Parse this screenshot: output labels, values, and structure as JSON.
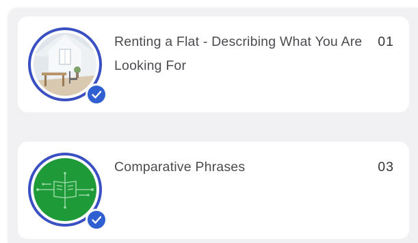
{
  "lessons": [
    {
      "title": "Renting a Flat - Describing What You Are Looking For",
      "number": "01",
      "thumbnail_icon": "room-interior-icon",
      "completed": true
    },
    {
      "title": "Comparative Phrases",
      "number": "03",
      "thumbnail_icon": "circuit-book-icon",
      "completed": true
    }
  ],
  "colors": {
    "ring": "#3a4fc2",
    "check_badge": "#2f5fd0",
    "card_bg": "#ffffff",
    "panel_bg": "#f1f1f3",
    "thumb2_green": "#1e9a38",
    "title_text": "#4a4a50"
  }
}
